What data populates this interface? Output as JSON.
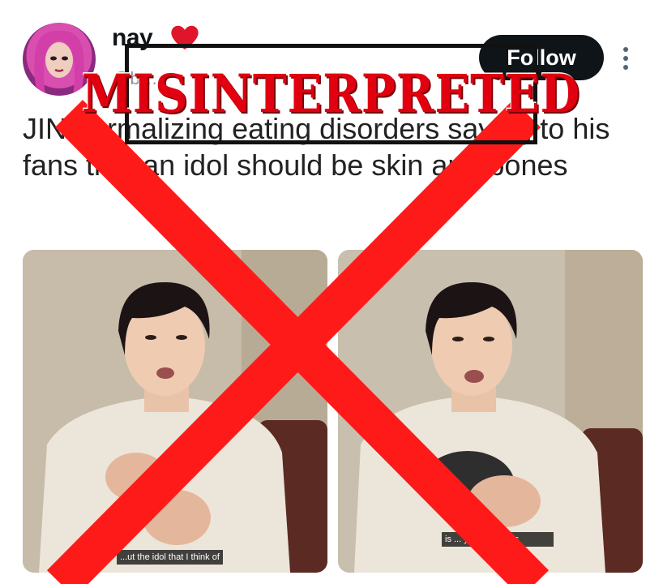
{
  "tweet": {
    "display_name": "nay",
    "handle": "@b…",
    "follow_label": "Follow",
    "text": "JIN normalizing eating disorders saying to his fans that an idol should be skin and bones",
    "media": [
      {
        "subtitle": "...ut the idol that I think of"
      },
      {
        "subtitle": "is ... y and all ... es"
      }
    ]
  },
  "overlay": {
    "stamp_text": "MISINTERPRETED",
    "stamp_color": "#e00010",
    "cross_color": "#ff1a1a"
  },
  "icons": {
    "heart": "heart-icon",
    "more": "more-vertical-icon"
  }
}
